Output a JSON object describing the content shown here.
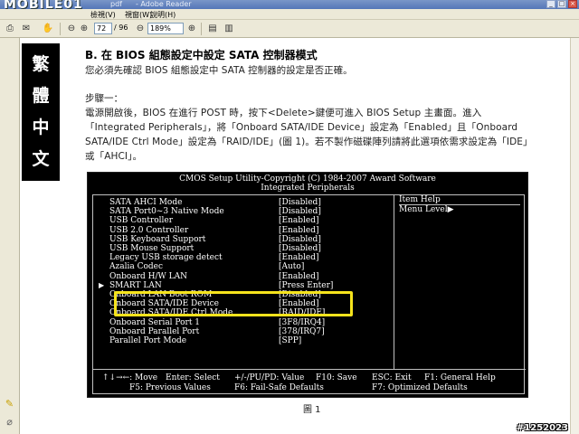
{
  "window": {
    "wordmark": "MOBILE01",
    "wordmark_suffix": "pdf",
    "title": "- Adobe Reader"
  },
  "menu": [
    "檢視(V)",
    "視窗(W)",
    "說明(H)"
  ],
  "toolbar": {
    "page_current": "72",
    "page_total": "/ 96",
    "zoom": "189%"
  },
  "side_tab": [
    "繁",
    "體",
    "中",
    "文"
  ],
  "document": {
    "section_title": "B. 在 BIOS 組態設定中設定 SATA 控制器模式",
    "intro": "您必須先確認 BIOS 組態設定中 SATA 控制器的設定是否正確。",
    "step_label": "步驟一：",
    "step_text": "電源開啟後，BIOS 在進行 POST 時，按下<Delete>鍵便可進入 BIOS Setup 主畫面。進入「Integrated Peripherals」，將「Onboard SATA/IDE Device」設定為「Enabled」且「Onboard SATA/IDE Ctrl Mode」設定為「RAID/IDE」(圖 1)。若不製作磁碟陣列請將此選項依需求設定為「IDE」或「AHCI」。",
    "caption": "圖 1"
  },
  "bios": {
    "header_line1": "CMOS Setup Utility-Copyright (C) 1984-2007 Award Software",
    "header_line2": "Integrated Peripherals",
    "items": [
      {
        "label": "SATA AHCI Mode",
        "value": "[Disabled]",
        "submenu": false
      },
      {
        "label": "SATA Port0~3 Native Mode",
        "value": "[Disabled]",
        "submenu": false
      },
      {
        "label": "USB Controller",
        "value": "[Enabled]",
        "submenu": false
      },
      {
        "label": "USB 2.0 Controller",
        "value": "[Enabled]",
        "submenu": false
      },
      {
        "label": "USB Keyboard Support",
        "value": "[Disabled]",
        "submenu": false
      },
      {
        "label": "USB Mouse Support",
        "value": "[Disabled]",
        "submenu": false
      },
      {
        "label": "Legacy USB storage detect",
        "value": "[Enabled]",
        "submenu": false
      },
      {
        "label": "Azalia Codec",
        "value": "[Auto]",
        "submenu": false
      },
      {
        "label": "Onboard H/W LAN",
        "value": "[Enabled]",
        "submenu": false
      },
      {
        "label": "SMART LAN",
        "value": "[Press Enter]",
        "submenu": true
      },
      {
        "label": "Onboard LAN Boot ROM",
        "value": "[Disabled]",
        "submenu": false
      },
      {
        "label": "Onboard SATA/IDE Device",
        "value": "[Enabled]",
        "submenu": false
      },
      {
        "label": "Onboard SATA/IDE Ctrl Mode",
        "value": "[RAID/IDE]",
        "submenu": false
      },
      {
        "label": "Onboard Serial Port 1",
        "value": "[3F8/IRQ4]",
        "submenu": false
      },
      {
        "label": "Onboard Parallel Port",
        "value": "[378/IRQ7]",
        "submenu": false
      },
      {
        "label": "Parallel Port Mode",
        "value": "[SPP]",
        "submenu": false
      }
    ],
    "help_header": "Item Help",
    "help_menu": "Menu Level▶",
    "footer": {
      "move": "↑↓→←: Move",
      "enter": "Enter: Select",
      "value": "+/-/PU/PD: Value",
      "save": "F10: Save",
      "exit": "ESC: Exit",
      "help": "F1: General Help",
      "prev": "F5: Previous Values",
      "failsafe": "F6: Fail-Safe Defaults",
      "optimized": "F7: Optimized Defaults"
    }
  },
  "watermark": "#1252023",
  "colors": {
    "highlight": "#f5e31c",
    "bios_bg": "#000000"
  }
}
